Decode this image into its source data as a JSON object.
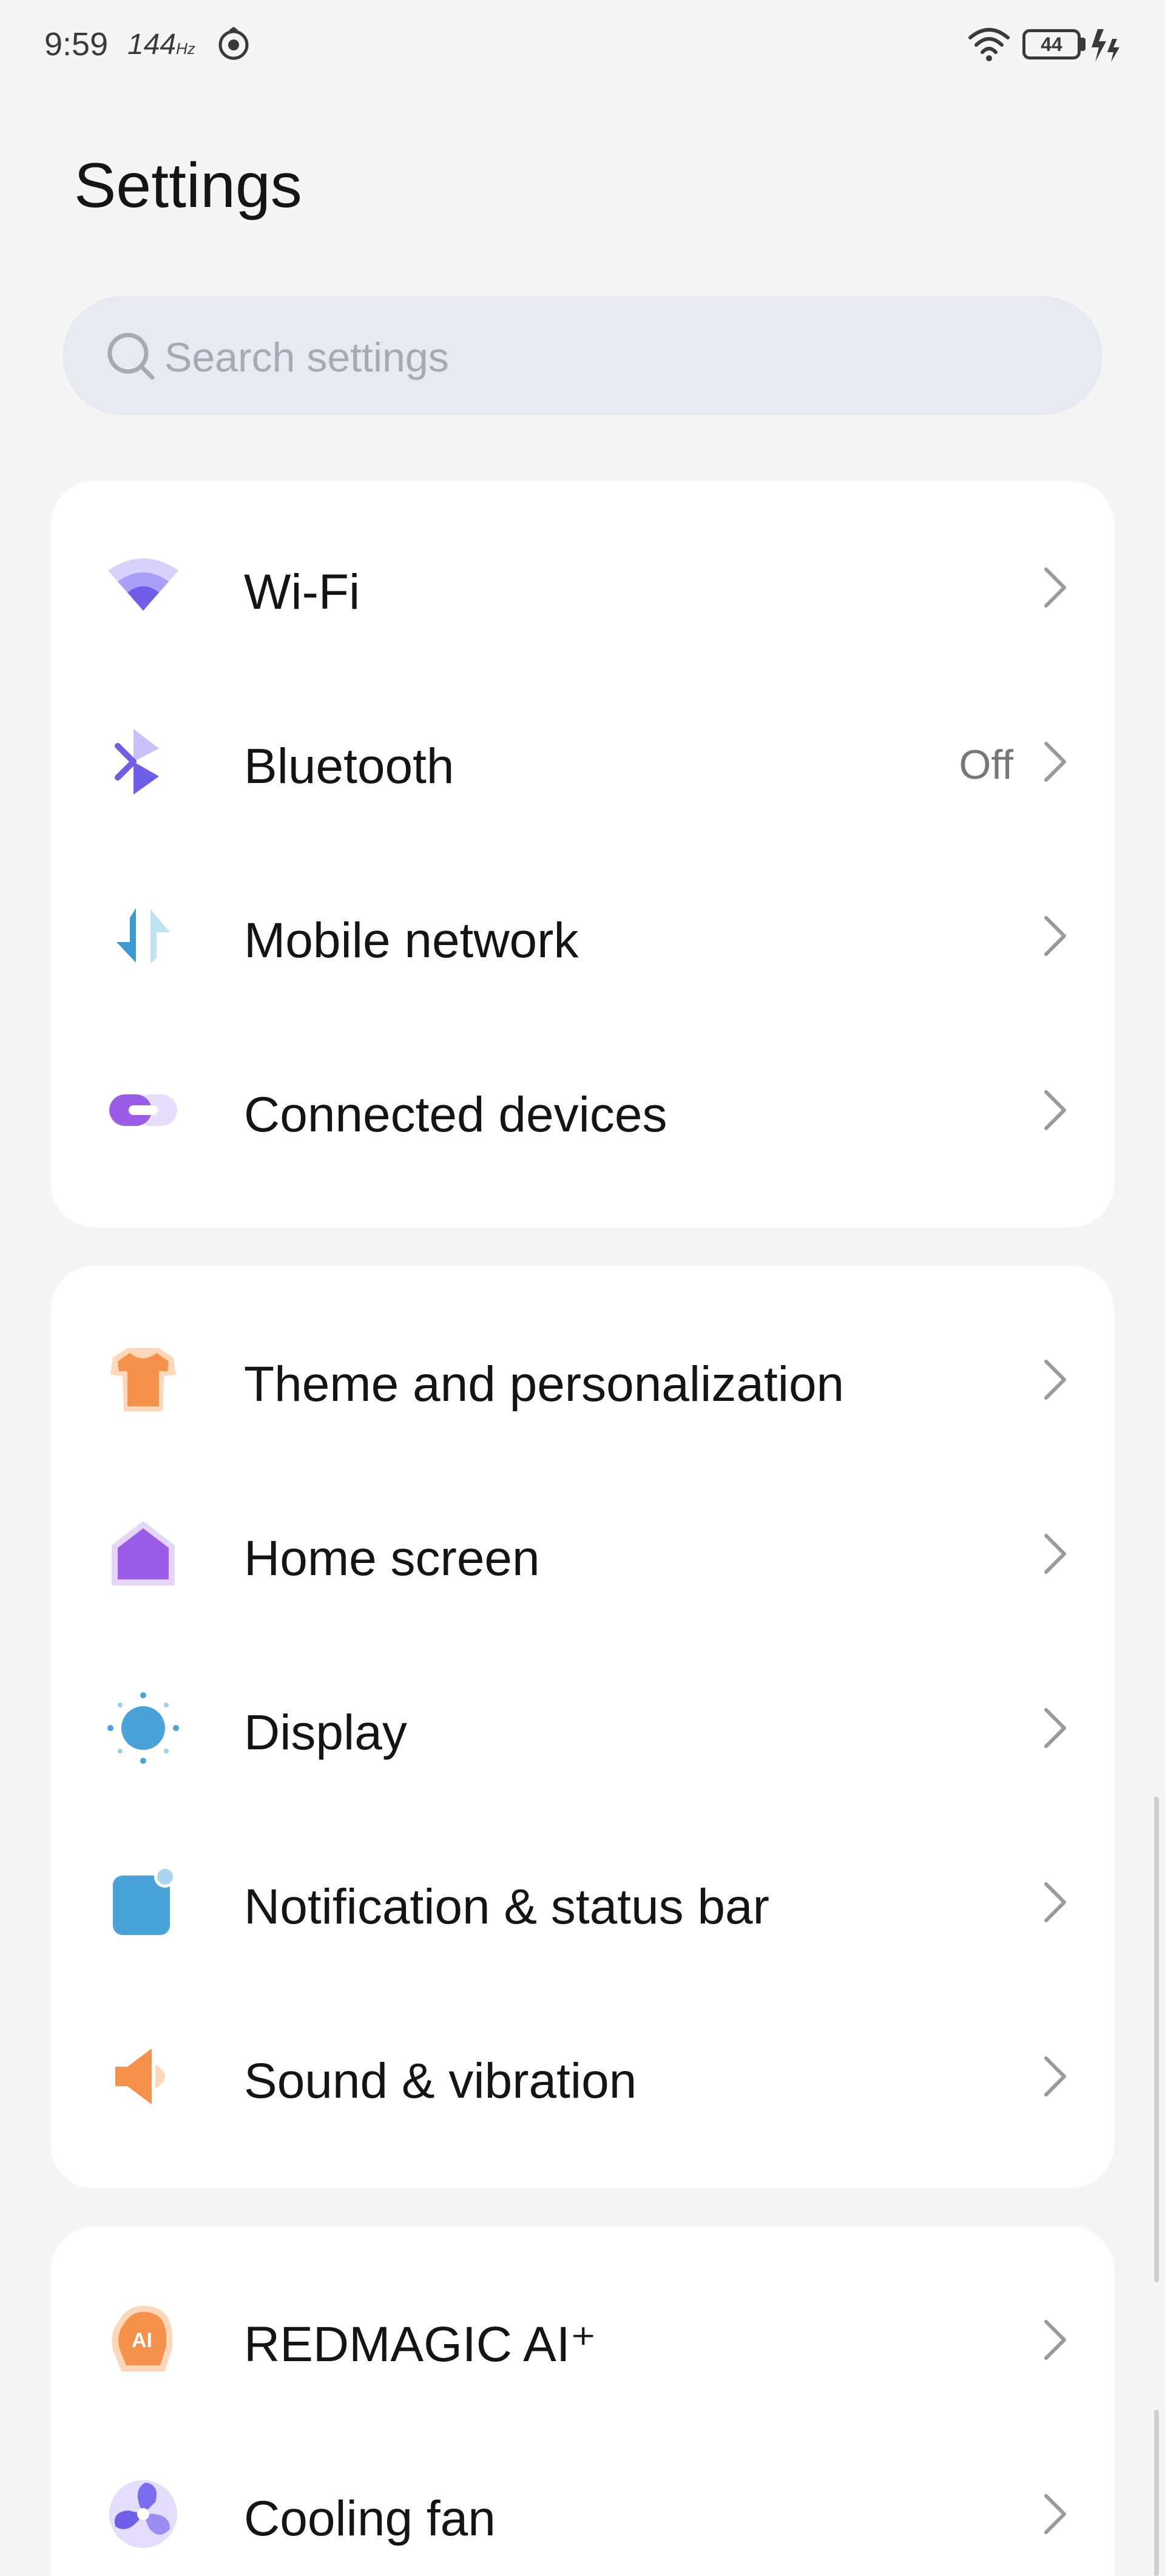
{
  "status_bar": {
    "time": "9:59",
    "refresh_rate": "144",
    "refresh_unit": "Hz",
    "battery": "44",
    "icons": [
      "sync-icon",
      "wifi-icon",
      "battery-icon",
      "charging-icon"
    ]
  },
  "page": {
    "title": "Settings"
  },
  "search": {
    "placeholder": "Search settings"
  },
  "groups": [
    {
      "items": [
        {
          "label": "Wi-Fi",
          "icon": "wifi-icon",
          "value": ""
        },
        {
          "label": "Bluetooth",
          "icon": "bluetooth-icon",
          "value": "Off"
        },
        {
          "label": "Mobile network",
          "icon": "mobile-network-icon",
          "value": ""
        },
        {
          "label": "Connected devices",
          "icon": "link-icon",
          "value": ""
        }
      ]
    },
    {
      "items": [
        {
          "label": "Theme and personalization",
          "icon": "tshirt-icon",
          "value": ""
        },
        {
          "label": "Home screen",
          "icon": "home-icon",
          "value": ""
        },
        {
          "label": "Display",
          "icon": "brightness-icon",
          "value": ""
        },
        {
          "label": "Notification & status bar",
          "icon": "notification-icon",
          "value": ""
        },
        {
          "label": "Sound & vibration",
          "icon": "speaker-icon",
          "value": ""
        }
      ]
    },
    {
      "items": [
        {
          "label": "REDMAGIC AI⁺",
          "icon": "ai-icon",
          "value": ""
        },
        {
          "label": "Cooling fan",
          "icon": "fan-icon",
          "value": ""
        }
      ]
    }
  ],
  "colors": {
    "background": "#f5f5f5",
    "card": "#ffffff",
    "search_bg": "#e9e9f1",
    "purple": "#7b6cf0",
    "orange": "#f5914a",
    "blue": "#4aa3d8"
  }
}
